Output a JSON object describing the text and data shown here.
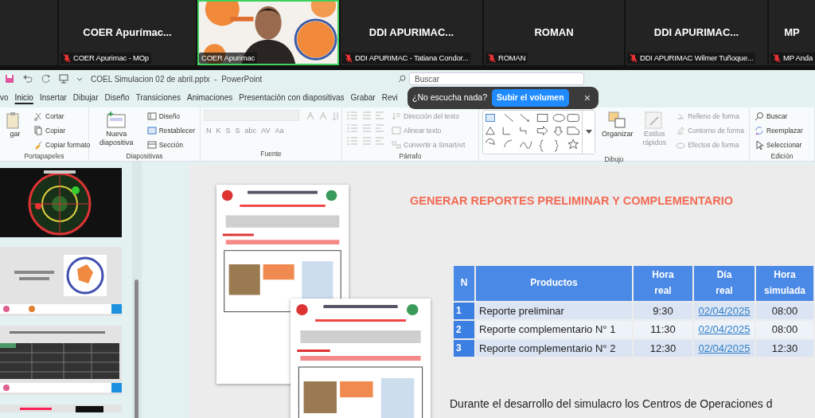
{
  "meeting": {
    "tiles": [
      {
        "kind": "blank"
      },
      {
        "kind": "name",
        "title": "COER  Apurímac...",
        "label": "COER Apurimac - MOp",
        "muted": true,
        "speaking": false
      },
      {
        "kind": "video",
        "label": "COER Apurimac",
        "muted": false,
        "speaking": true
      },
      {
        "kind": "name",
        "title": "DDI APURIMAC...",
        "label": "DDI APURIMAC - Tatiana Condor...",
        "muted": true,
        "speaking": false
      },
      {
        "kind": "name",
        "title": "ROMAN",
        "label": "ROMAN",
        "muted": true,
        "speaking": false
      },
      {
        "kind": "name",
        "title": "DDI APURIMAC...",
        "label": "DDI APURIMAC Wilmer Tuñoque...",
        "muted": true,
        "speaking": false
      },
      {
        "kind": "name",
        "title": "MP",
        "label": "MP Anda",
        "muted": true,
        "speaking": false
      }
    ]
  },
  "window": {
    "title": "COEL Simulacion 02 de abril.pptx  -  PowerPoint",
    "search": {
      "placeholder": "Buscar"
    }
  },
  "tabs": [
    {
      "label": "vo",
      "selected": false
    },
    {
      "label": "Inicio",
      "selected": true
    },
    {
      "label": "Insertar",
      "selected": false
    },
    {
      "label": "Dibujar",
      "selected": false
    },
    {
      "label": "Diseño",
      "selected": false
    },
    {
      "label": "Transiciones",
      "selected": false
    },
    {
      "label": "Animaciones",
      "selected": false
    },
    {
      "label": "Presentación con diapositivas",
      "selected": false
    },
    {
      "label": "Grabar",
      "selected": false
    },
    {
      "label": "Revi",
      "selected": false
    }
  ],
  "toast": {
    "message": "¿No escucha nada?",
    "button": "Subir el volumen",
    "close": "×"
  },
  "ribbon": [
    {
      "kind": "clipboard",
      "label": "Portapapeles",
      "columns": [
        [
          {
            "kind": "big",
            "label": "gar",
            "disabled": false
          }
        ],
        [
          {
            "kind": "small",
            "label": "Cortar",
            "disabled": false
          },
          {
            "kind": "small",
            "label": "Copiar",
            "disabled": false
          },
          {
            "kind": "small",
            "label": "Copiar formato",
            "disabled": false
          }
        ]
      ]
    },
    {
      "kind": "slides",
      "label": "Diapositivas",
      "columns": [
        [
          {
            "kind": "big",
            "label": "Nueva diapositiva",
            "disabled": false
          }
        ],
        [
          {
            "kind": "small",
            "label": "Diseño",
            "disabled": false
          },
          {
            "kind": "small",
            "label": "Restablecer",
            "disabled": false
          },
          {
            "kind": "small",
            "label": "Sección",
            "disabled": false
          }
        ]
      ]
    },
    {
      "kind": "font",
      "label": "Fuente",
      "columns": [
        [
          {
            "kind": "fontbox",
            "disabled": true
          },
          {
            "kind": "glyphs",
            "labels": [
              "N",
              "K",
              "S",
              "S",
              "abc",
              "AV",
              "Aa"
            ],
            "disabled": true
          }
        ]
      ]
    },
    {
      "kind": "paragraph",
      "label": "Párrafo",
      "columns": [
        [
          {
            "kind": "iconrow",
            "disabled": true
          },
          {
            "kind": "iconrow",
            "disabled": true
          },
          {
            "kind": "iconrow",
            "disabled": true
          }
        ],
        [
          {
            "kind": "small",
            "label": "Dirección del texto",
            "disabled": true
          },
          {
            "kind": "small",
            "label": "Alinear texto",
            "disabled": true
          },
          {
            "kind": "small",
            "label": "Convertir a SmartArt",
            "disabled": true
          }
        ]
      ]
    },
    {
      "kind": "drawing",
      "label": "Dibujo",
      "columns": [
        [
          {
            "kind": "gallery",
            "disabled": false
          }
        ],
        [
          {
            "kind": "big",
            "label": "Organizar",
            "disabled": false
          }
        ],
        [
          {
            "kind": "big",
            "label": "Estilos rápidos",
            "disabled": true
          }
        ],
        [
          {
            "kind": "small",
            "label": "Relleno de forma",
            "disabled": true
          },
          {
            "kind": "small",
            "label": "Contorno de forma",
            "disabled": true
          },
          {
            "kind": "small",
            "label": "Efectos de forma",
            "disabled": true
          }
        ]
      ]
    },
    {
      "kind": "editing",
      "label": "Edición",
      "columns": [
        [
          {
            "kind": "small",
            "label": "Buscar",
            "disabled": false
          },
          {
            "kind": "small",
            "label": "Reemplazar",
            "disabled": false
          },
          {
            "kind": "small",
            "label": "Seleccionar",
            "disabled": false
          }
        ]
      ]
    }
  ],
  "slide": {
    "title": "GENERAR REPORTES PRELIMINAR Y COMPLEMENTARIO",
    "table": {
      "columns": [
        {
          "lines": [
            "N"
          ]
        },
        {
          "lines": [
            "Productos"
          ]
        },
        {
          "lines": [
            "Hora",
            "real"
          ]
        },
        {
          "lines": [
            "Día",
            "real"
          ]
        },
        {
          "lines": [
            "Hora",
            "simulada"
          ]
        }
      ],
      "rows": [
        {
          "n": "1",
          "product": "Reporte preliminar",
          "real_time": "9:30",
          "real_day": "02/04/2025",
          "simulated_time": "08:00"
        },
        {
          "n": "2",
          "product": "Reporte complementario N° 1",
          "real_time": "11:30",
          "real_day": "02/04/2025",
          "simulated_time": "08:00"
        },
        {
          "n": "3",
          "product": "Reporte complementario N° 2",
          "real_time": "12:30",
          "real_day": "02/04/2025",
          "simulated_time": "12:30"
        }
      ]
    },
    "body": "Durante el desarrollo del simulacro los Centros de Operaciones d"
  }
}
